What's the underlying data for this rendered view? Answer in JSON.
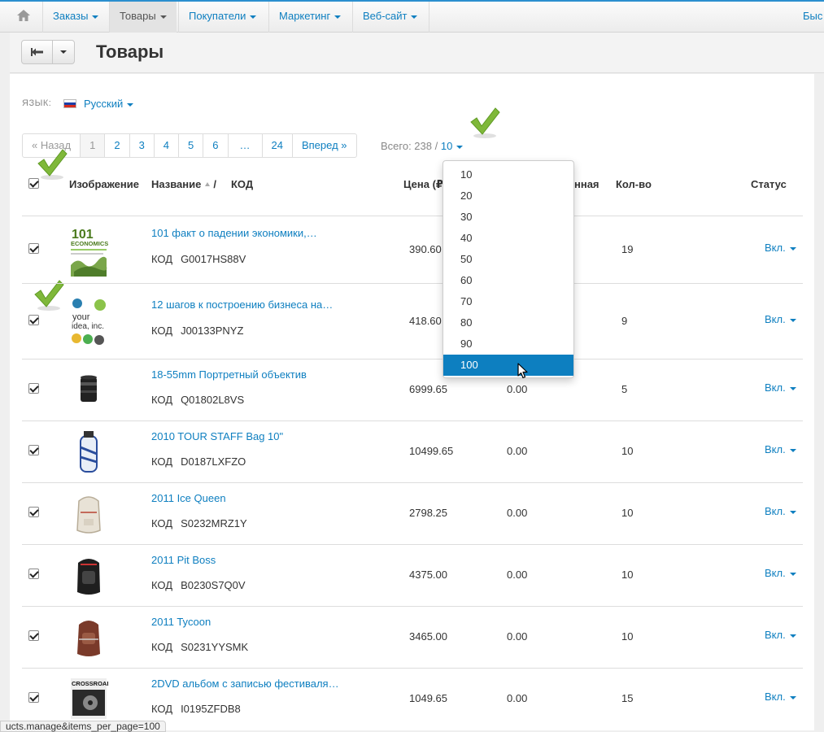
{
  "nav": {
    "items": [
      {
        "label": "Заказы",
        "active": false
      },
      {
        "label": "Товары",
        "active": true
      },
      {
        "label": "Покупатели",
        "active": false
      },
      {
        "label": "Маркетинг",
        "active": false
      },
      {
        "label": "Веб-сайт",
        "active": false
      }
    ],
    "right_label": "Быс"
  },
  "page": {
    "title": "Товары"
  },
  "language": {
    "label": "ЯЗЫК:",
    "value": "Русский"
  },
  "pagination": {
    "prev": "« Назад",
    "pages": [
      "1",
      "2",
      "3",
      "4",
      "5",
      "6",
      "…",
      "24"
    ],
    "current": "1",
    "next": "Вперед »",
    "total_label": "Всего: 238 /",
    "per_page": "10"
  },
  "table": {
    "headers": {
      "image": "Изображение",
      "name": "Название",
      "code": "КОД",
      "price": "Цена (₽",
      "list_price_partial": "нная",
      "qty": "Кол-во",
      "status": "Статус"
    },
    "code_label": "КОД",
    "rows": [
      {
        "name": "101 факт о падении экономики,…",
        "code": "G0017HS88V",
        "price": "390.60",
        "list_price": "",
        "qty": "19",
        "status": "Вкл."
      },
      {
        "name": "12 шагов к построению бизнеса на…",
        "code": "J00133PNYZ",
        "price": "418.60",
        "list_price": "",
        "qty": "9",
        "status": "Вкл."
      },
      {
        "name": "18-55mm Портретный объектив",
        "code": "Q01802L8VS",
        "price": "6999.65",
        "list_price": "0.00",
        "qty": "5",
        "status": "Вкл."
      },
      {
        "name": "2010 TOUR STAFF Bag 10\"",
        "code": "D0187LXFZO",
        "price": "10499.65",
        "list_price": "0.00",
        "qty": "10",
        "status": "Вкл."
      },
      {
        "name": "2011 Ice Queen",
        "code": "S0232MRZ1Y",
        "price": "2798.25",
        "list_price": "0.00",
        "qty": "10",
        "status": "Вкл."
      },
      {
        "name": "2011 Pit Boss",
        "code": "B0230S7Q0V",
        "price": "4375.00",
        "list_price": "0.00",
        "qty": "10",
        "status": "Вкл."
      },
      {
        "name": "2011 Tycoon",
        "code": "S0231YYSMK",
        "price": "3465.00",
        "list_price": "0.00",
        "qty": "10",
        "status": "Вкл."
      },
      {
        "name": "2DVD альбом с записью фестиваля…",
        "code": "I0195ZFDB8",
        "price": "1049.65",
        "list_price": "0.00",
        "qty": "15",
        "status": "Вкл."
      }
    ],
    "thumb_text": {
      "book1_big": "101",
      "book1_word": "ECONOMICS",
      "book2_line1": "your",
      "book2_line2": "idea, inc.",
      "dvd": "CROSSROADS"
    }
  },
  "per_page_dropdown": {
    "options": [
      "10",
      "20",
      "30",
      "40",
      "50",
      "60",
      "70",
      "80",
      "90",
      "100"
    ],
    "highlighted": "100"
  },
  "statusbar": {
    "text": "ucts.manage&items_per_page=100"
  },
  "colors": {
    "accent": "#0e7fc0",
    "check_green": "#7fb83a",
    "selected_bg": "#0d7fc0"
  }
}
